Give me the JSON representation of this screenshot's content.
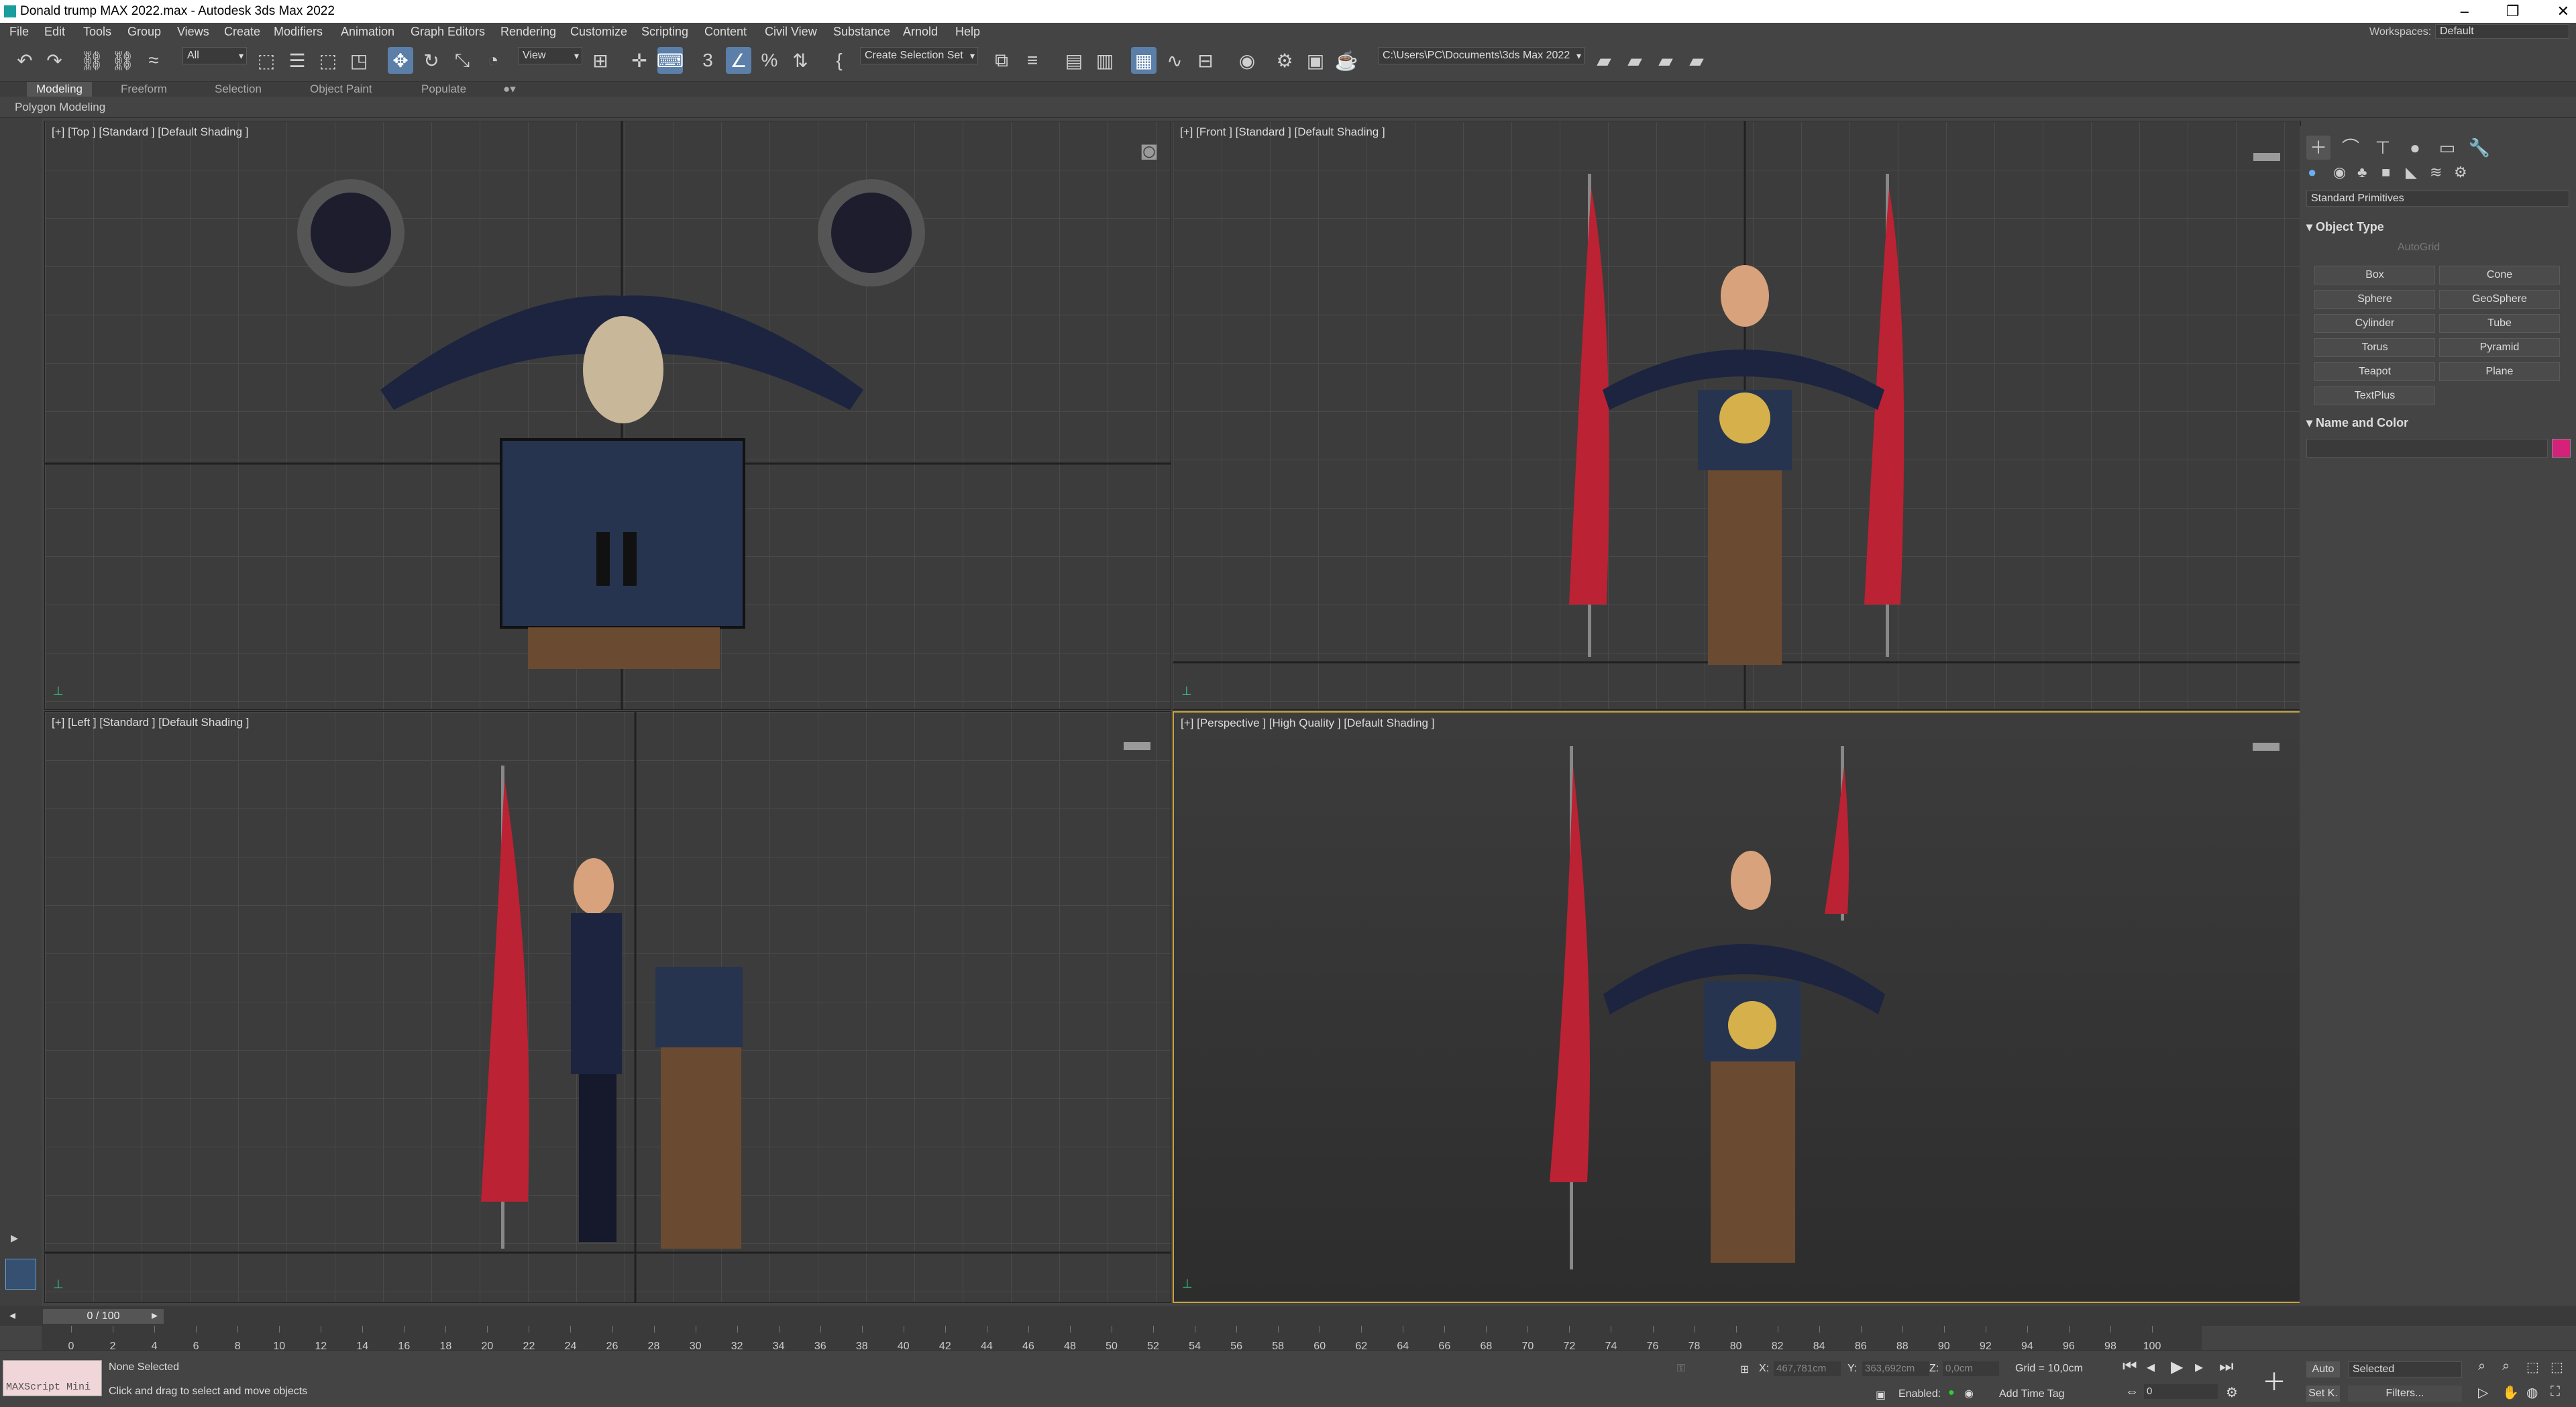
{
  "window": {
    "title": "Donald trump MAX 2022.max - Autodesk 3ds Max 2022"
  },
  "menu": [
    "File",
    "Edit",
    "Tools",
    "Group",
    "Views",
    "Create",
    "Modifiers",
    "Animation",
    "Graph Editors",
    "Rendering",
    "Customize",
    "Scripting",
    "Content",
    "Civil View",
    "Substance",
    "Arnold",
    "Help"
  ],
  "workspace": {
    "label": "Workspaces:",
    "value": "Default"
  },
  "toolbar": {
    "filter": "All",
    "ref_coord": "View",
    "selection_set": "Create Selection Set",
    "project_path": "C:\\Users\\PC\\Documents\\3ds Max 2022"
  },
  "ribbon": {
    "tabs": [
      "Modeling",
      "Freeform",
      "Selection",
      "Object Paint",
      "Populate"
    ],
    "active": "Modeling",
    "panel_label": "Polygon Modeling"
  },
  "viewports": {
    "top": "[+] [Top ] [Standard ] [Default Shading ]",
    "front": "[+] [Front ] [Standard ] [Default Shading ]",
    "left": "[+] [Left ] [Standard ] [Default Shading ]",
    "persp": "[+] [Perspective ] [High Quality ] [Default Shading ]"
  },
  "command_panel": {
    "category": "Standard Primitives",
    "object_type_title": "Object Type",
    "autogrid": "AutoGrid",
    "buttons": [
      "Box",
      "Cone",
      "Sphere",
      "GeoSphere",
      "Cylinder",
      "Tube",
      "Torus",
      "Pyramid",
      "Teapot",
      "Plane",
      "TextPlus"
    ],
    "name_color_title": "Name and Color",
    "object_color": "#d4227a"
  },
  "timeline": {
    "frame_display": "0 / 100",
    "ticks": [
      "0",
      "2",
      "4",
      "6",
      "8",
      "10",
      "12",
      "14",
      "16",
      "18",
      "20",
      "22",
      "24",
      "26",
      "28",
      "30",
      "32",
      "34",
      "36",
      "38",
      "40",
      "42",
      "44",
      "46",
      "48",
      "50",
      "52",
      "54",
      "56",
      "58",
      "60",
      "62",
      "64",
      "66",
      "68",
      "70",
      "72",
      "74",
      "76",
      "78",
      "80",
      "82",
      "84",
      "86",
      "88",
      "90",
      "92",
      "94",
      "96",
      "98",
      "100"
    ]
  },
  "status": {
    "maxscript": "MAXScript Mini",
    "selection": "None Selected",
    "prompt": "Click and drag to select and move objects",
    "x_label": "X:",
    "x_value": "467,781cm",
    "y_label": "Y:",
    "y_value": "363,692cm",
    "z_label": "Z:",
    "z_value": "0,0cm",
    "grid": "Grid = 10,0cm",
    "enabled": "Enabled:",
    "add_time_tag": "Add Time Tag",
    "auto": "Auto",
    "selected": "Selected",
    "set_key": "Set K.",
    "filters": "Filters...",
    "frame": "0"
  }
}
